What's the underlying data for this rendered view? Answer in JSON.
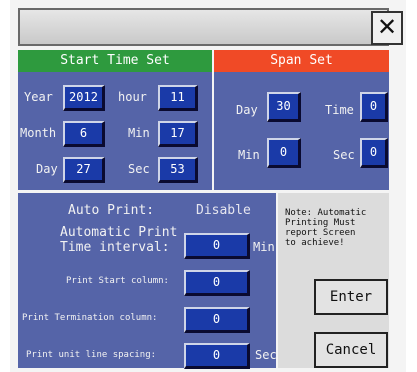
{
  "start_time": {
    "header": "Start Time Set",
    "year_label": "Year",
    "year": "2012",
    "hour_label": "hour",
    "hour": "11",
    "month_label": "Month",
    "month": "6",
    "min_label": "Min",
    "min": "17",
    "day_label": "Day",
    "day": "27",
    "sec_label": "Sec",
    "sec": "53"
  },
  "span": {
    "header": "Span Set",
    "day_label": "Day",
    "day": "30",
    "time_label": "Time",
    "time": "0",
    "min_label": "Min",
    "min": "0",
    "sec_label": "Sec",
    "sec": "0"
  },
  "auto_print": {
    "label": "Auto Print:",
    "status": "Disable",
    "interval_label_1": "Automatic Print",
    "interval_label_2": "Time interval:",
    "interval": "0",
    "interval_unit": "Min",
    "start_col_label": "Print Start column:",
    "start_col": "0",
    "term_col_label": "Print Termination column:",
    "term_col": "0",
    "line_spacing_label": "Print unit line spacing:",
    "line_spacing": "0",
    "line_spacing_unit": "Sec"
  },
  "note": {
    "line1": "Note: Automatic",
    "line2": "Printing Must",
    "line3": "report Screen",
    "line4": "to achieve!"
  },
  "buttons": {
    "enter": "Enter",
    "cancel": "Cancel",
    "close": "✕"
  },
  "colors": {
    "panel": "#5564a8",
    "start_header": "#2e9a3e",
    "span_header": "#f04a26",
    "value_box": "#1a3aa8"
  }
}
